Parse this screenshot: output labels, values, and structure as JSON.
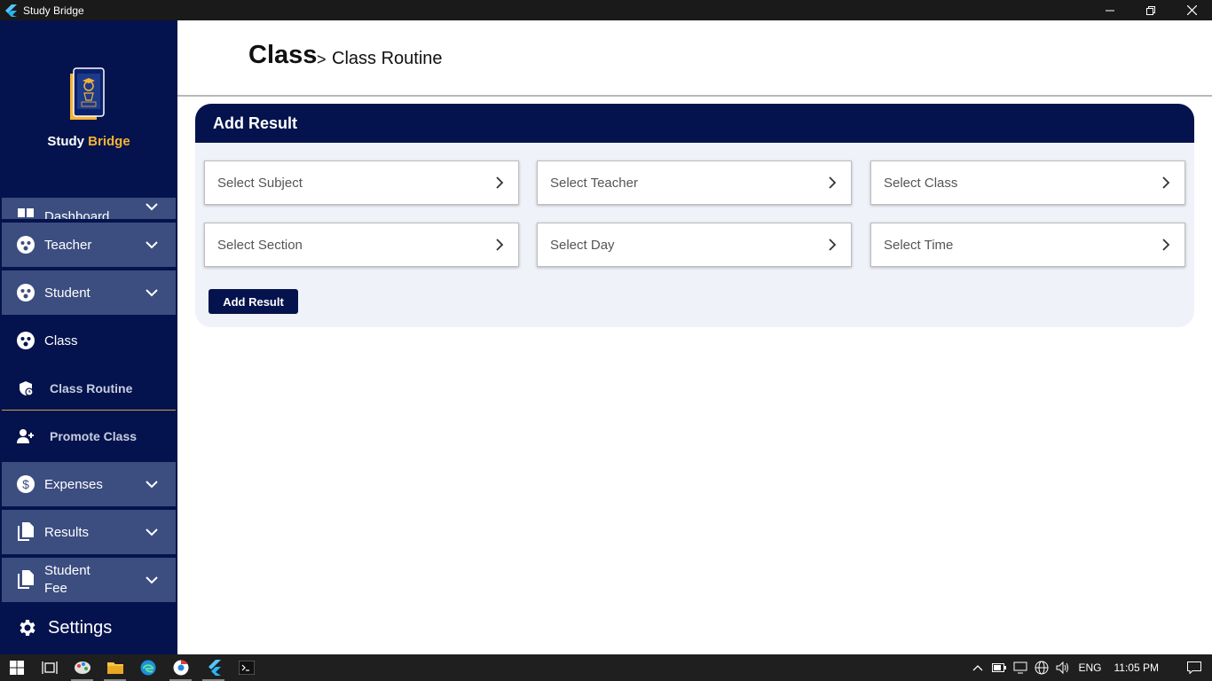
{
  "window": {
    "title": "Study Bridge"
  },
  "sidebar": {
    "brand_part1": "Study",
    "brand_part2": "Bridge",
    "items": [
      {
        "label": "Dashboard"
      },
      {
        "label": "Teacher"
      },
      {
        "label": "Student"
      },
      {
        "label": "Class"
      },
      {
        "label": "Class Routine"
      },
      {
        "label": "Promote Class"
      },
      {
        "label": "Expenses"
      },
      {
        "label": "Results"
      },
      {
        "label": "Student Fee"
      }
    ],
    "settings_label": "Settings"
  },
  "header": {
    "title": "Class",
    "separator": ">",
    "subtitle": "Class Routine"
  },
  "form": {
    "heading": "Add Result",
    "fields": {
      "subject": "Select Subject",
      "teacher": "Select Teacher",
      "class": "Select Class",
      "section": "Select Section",
      "day": "Select Day",
      "time": "Select Time"
    },
    "submit_label": "Add Result"
  },
  "taskbar": {
    "language": "ENG",
    "time": "11:05 PM"
  },
  "colors": {
    "primary": "#04134d",
    "sidebar_item": "#3c4e80",
    "accent": "#f5b335",
    "card_bg": "#eff2f8"
  }
}
